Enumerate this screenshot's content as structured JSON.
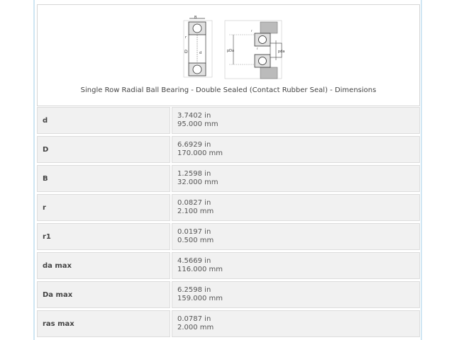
{
  "header": {
    "caption": "Single Row Radial Ball Bearing - Double Sealed (Contact Rubber Seal) - Dimensions",
    "diagram": {
      "labels": [
        "B",
        "r",
        "D",
        "d",
        "r",
        "pDa",
        "pda",
        "r"
      ]
    }
  },
  "dimensions": [
    {
      "name": "d",
      "in": "3.7402 in",
      "mm": "95.000 mm"
    },
    {
      "name": "D",
      "in": "6.6929 in",
      "mm": "170.000 mm"
    },
    {
      "name": "B",
      "in": "1.2598 in",
      "mm": "32.000 mm"
    },
    {
      "name": "r",
      "in": "0.0827 in",
      "mm": "2.100 mm"
    },
    {
      "name": "r1",
      "in": "0.0197 in",
      "mm": "0.500 mm"
    },
    {
      "name": "da max",
      "in": "4.5669 in",
      "mm": "116.000 mm"
    },
    {
      "name": "Da max",
      "in": "6.2598 in",
      "mm": "159.000 mm"
    },
    {
      "name": "ras max",
      "in": "0.0787 in",
      "mm": "2.000 mm"
    }
  ]
}
